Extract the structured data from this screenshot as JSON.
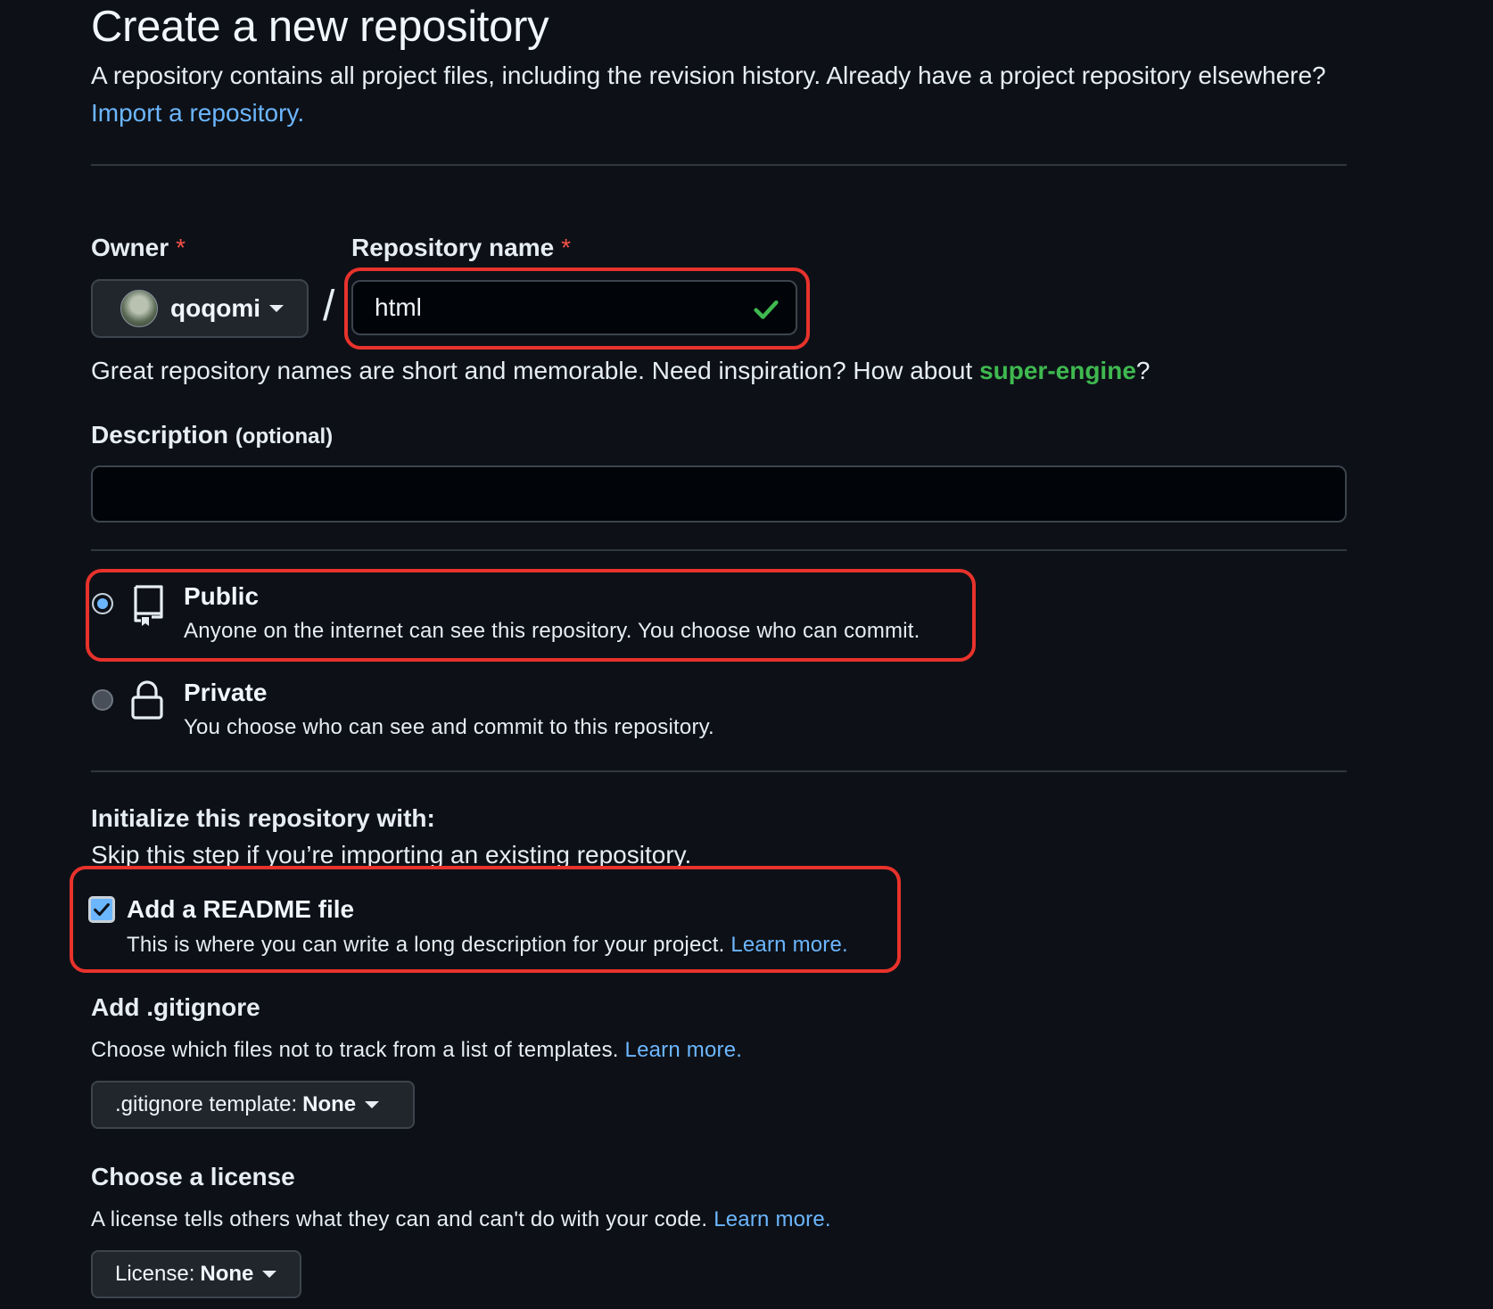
{
  "header": {
    "title": "Create a new repository",
    "intro_text": "A repository contains all project files, including the revision history. Already have a project repository elsewhere? ",
    "import_link": "Import a repository."
  },
  "owner": {
    "label": "Owner",
    "required_mark": "*",
    "value": "qoqomi"
  },
  "separator": "/",
  "repo_name": {
    "label": "Repository name",
    "required_mark": "*",
    "value": "html"
  },
  "name_hint": {
    "text_before": "Great repository names are short and memorable. Need inspiration? How about ",
    "suggestion": "super-engine",
    "text_after": "?"
  },
  "description": {
    "label": "Description",
    "optional": "(optional)",
    "value": ""
  },
  "visibility": {
    "public": {
      "title": "Public",
      "description": "Anyone on the internet can see this repository. You choose who can commit.",
      "selected": true
    },
    "private": {
      "title": "Private",
      "description": "You choose who can see and commit to this repository.",
      "selected": false
    }
  },
  "init": {
    "heading": "Initialize this repository with:",
    "subtext": "Skip this step if you’re importing an existing repository.",
    "readme": {
      "label": "Add a README file",
      "description": "This is where you can write a long description for your project. ",
      "link": "Learn more.",
      "checked": true
    }
  },
  "gitignore": {
    "heading": "Add .gitignore",
    "description": "Choose which files not to track from a list of templates. ",
    "link": "Learn more.",
    "select_label": ".gitignore template:",
    "select_value": "None"
  },
  "license": {
    "heading": "Choose a license",
    "description": "A license tells others what they can and can't do with your code. ",
    "link": "Learn more.",
    "select_label": "License:",
    "select_value": "None"
  },
  "colors": {
    "background": "#0d1117",
    "link": "#4493f8",
    "suggestion": "#3fb950",
    "highlight": "#e8322c"
  }
}
